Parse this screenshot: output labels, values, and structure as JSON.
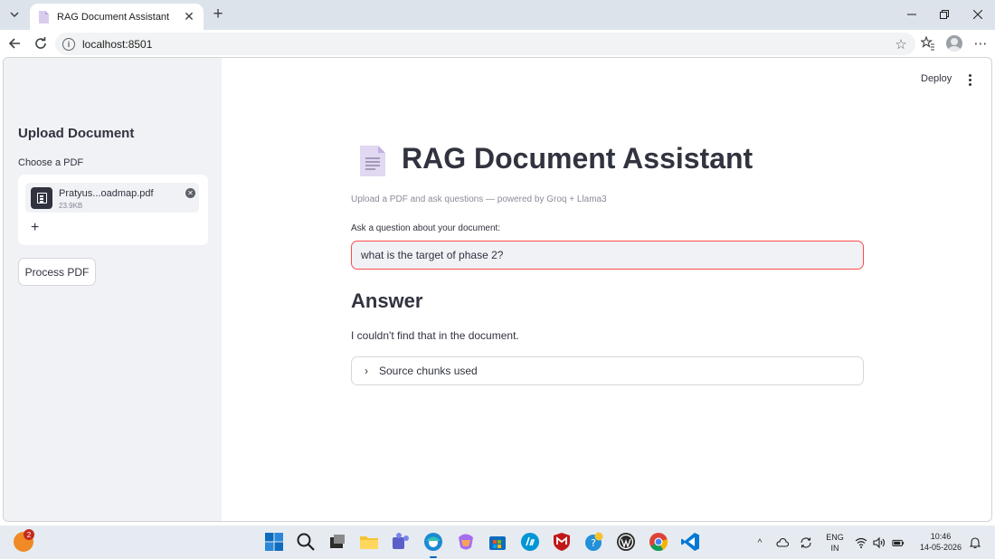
{
  "browser": {
    "tab_title": "RAG Document Assistant",
    "tab_close": "✕",
    "new_tab": "+",
    "url": "localhost:8501",
    "info_glyph": "i",
    "star_glyph": "☆",
    "more_glyph": "⋯"
  },
  "sidebar": {
    "title": "Upload Document",
    "uploader_label": "Choose a PDF",
    "file": {
      "name": "Pratyus...oadmap.pdf",
      "size": "23.9KB"
    },
    "remove_glyph": "✕",
    "add_glyph": "+",
    "process_button": "Process PDF"
  },
  "header": {
    "deploy": "Deploy"
  },
  "main": {
    "title": "RAG Document Assistant",
    "caption": "Upload a PDF and ask questions — powered by Groq + Llama3",
    "question_label": "Ask a question about your document:",
    "question_value": "what is the target of phase 2?",
    "answer_heading": "Answer",
    "answer_text": "I couldn't find that in the document.",
    "expander_label": "Source chunks used",
    "expander_chevron": "›"
  },
  "taskbar": {
    "notification_count": "2",
    "language": "ENG",
    "region": "IN",
    "time": "10:46",
    "date": "14-05-2026",
    "overflow_glyph": "^"
  },
  "colors": {
    "accent": "#ff4b4b",
    "sidebar_bg": "#f0f2f6",
    "text": "#31333f"
  }
}
